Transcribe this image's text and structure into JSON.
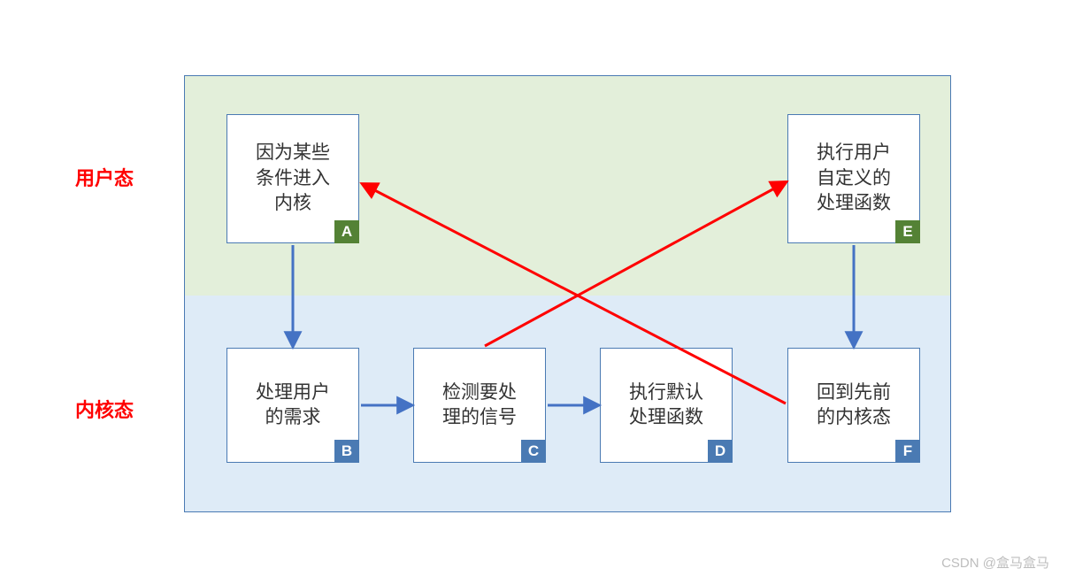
{
  "labels": {
    "user_mode": "用户态",
    "kernel_mode": "内核态"
  },
  "nodes": {
    "A": {
      "text": "因为某些\n条件进入\n内核",
      "tag": "A",
      "tag_color": "green"
    },
    "B": {
      "text": "处理用户\n的需求",
      "tag": "B",
      "tag_color": "blue"
    },
    "C": {
      "text": "检测要处\n理的信号",
      "tag": "C",
      "tag_color": "blue"
    },
    "D": {
      "text": "执行默认\n处理函数",
      "tag": "D",
      "tag_color": "blue"
    },
    "E": {
      "text": "执行用户\n自定义的\n处理函数",
      "tag": "E",
      "tag_color": "green"
    },
    "F": {
      "text": "回到先前\n的内核态",
      "tag": "F",
      "tag_color": "blue"
    }
  },
  "arrows": {
    "blue": [
      {
        "from": "A",
        "to": "B"
      },
      {
        "from": "B",
        "to": "C"
      },
      {
        "from": "C",
        "to": "D"
      },
      {
        "from": "E",
        "to": "F"
      }
    ],
    "red": [
      {
        "from": "C",
        "to": "E"
      },
      {
        "from": "F",
        "to": "A"
      }
    ]
  },
  "colors": {
    "blue_arrow": "#4472c4",
    "red_arrow": "#ff0000",
    "border": "#4a7ab3",
    "tag_green": "#548235",
    "tag_blue": "#4a7ab3"
  },
  "watermark": "CSDN @盒马盒马"
}
